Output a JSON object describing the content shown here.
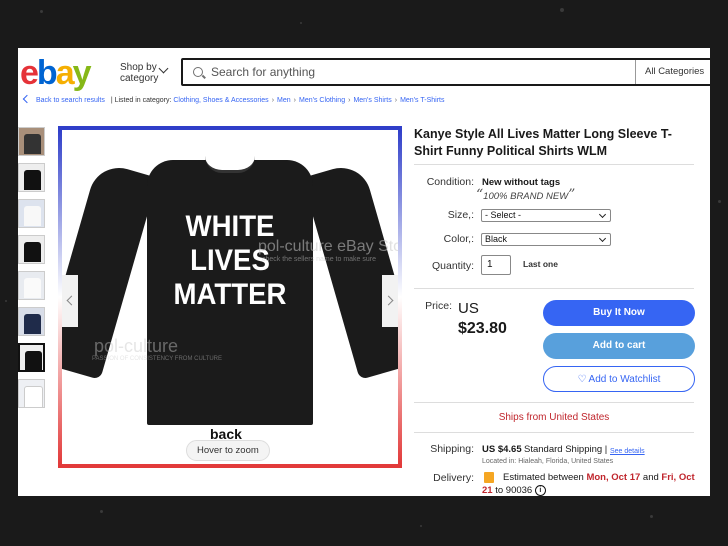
{
  "header": {
    "logo_letters": [
      {
        "char": "e",
        "color": "#e53238"
      },
      {
        "char": "b",
        "color": "#0064d2"
      },
      {
        "char": "a",
        "color": "#f5af02"
      },
      {
        "char": "y",
        "color": "#86b817"
      }
    ],
    "shop_by_line1": "Shop by",
    "shop_by_line2": "category",
    "search_placeholder": "Search for anything",
    "category_select": "All Categories"
  },
  "breadcrumb": {
    "back": "Back to search results",
    "listed_in": "| Listed in category:",
    "items": [
      "Clothing, Shoes & Accessories",
      "Men",
      "Men's Clothing",
      "Men's Shirts",
      "Men's T-Shirts"
    ]
  },
  "gallery": {
    "shirt_text": [
      "WHITE",
      "LIVES",
      "MATTER"
    ],
    "watermark_main": "pol-culture",
    "watermark_store": "pol-culture eBay Store",
    "watermark_sub": "check the sellers name to make sure",
    "watermark_sub2": "PASSION OF CONSISTENCY FROM CULTURE",
    "image_caption": "back",
    "zoom_hint": "Hover to zoom",
    "thumbnail_count": 8,
    "selected_thumbnail": 7
  },
  "listing": {
    "title": "Kanye Style All Lives Matter Long Sleeve T-Shirt Funny Political Shirts WLM",
    "condition_label": "Condition:",
    "condition_value": "New without tags",
    "condition_note": "100% BRAND NEW",
    "size_label": "Size,:",
    "size_value": "- Select -",
    "color_label": "Color,:",
    "color_value": "Black",
    "quantity_label": "Quantity:",
    "quantity_value": "1",
    "last_one": "Last one",
    "price_label": "Price:",
    "price_currency": "US",
    "price_value": "$23.80",
    "buy_now": "Buy It Now",
    "add_to_cart": "Add to cart",
    "add_to_watchlist": "Add to Watchlist",
    "ships_from": "Ships from United States",
    "shipping_label": "Shipping:",
    "shipping_value": "US $4.65",
    "shipping_method": "Standard Shipping |",
    "see_details": "See details",
    "located_in": "Located in: Hialeah, Florida, United States",
    "delivery_label": "Delivery:",
    "delivery_prefix": "Estimated between",
    "delivery_start": "Mon, Oct 17",
    "delivery_and": "and",
    "delivery_end": "Fri, Oct",
    "delivery_end2": "21",
    "delivery_zip": "to 90036"
  },
  "colors": {
    "link": "#3665f3",
    "buy_button": "#3665f3",
    "ships_red": "#c0262d"
  }
}
